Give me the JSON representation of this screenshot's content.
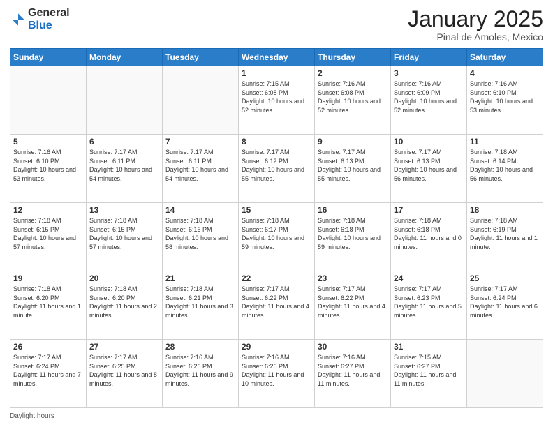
{
  "header": {
    "logo_general": "General",
    "logo_blue": "Blue",
    "month_title": "January 2025",
    "location": "Pinal de Amoles, Mexico"
  },
  "days_of_week": [
    "Sunday",
    "Monday",
    "Tuesday",
    "Wednesday",
    "Thursday",
    "Friday",
    "Saturday"
  ],
  "weeks": [
    [
      {
        "num": "",
        "empty": true
      },
      {
        "num": "",
        "empty": true
      },
      {
        "num": "",
        "empty": true
      },
      {
        "num": "1",
        "sunrise": "7:15 AM",
        "sunset": "6:08 PM",
        "daylight": "10 hours and 52 minutes."
      },
      {
        "num": "2",
        "sunrise": "7:16 AM",
        "sunset": "6:08 PM",
        "daylight": "10 hours and 52 minutes."
      },
      {
        "num": "3",
        "sunrise": "7:16 AM",
        "sunset": "6:09 PM",
        "daylight": "10 hours and 52 minutes."
      },
      {
        "num": "4",
        "sunrise": "7:16 AM",
        "sunset": "6:10 PM",
        "daylight": "10 hours and 53 minutes."
      }
    ],
    [
      {
        "num": "5",
        "sunrise": "7:16 AM",
        "sunset": "6:10 PM",
        "daylight": "10 hours and 53 minutes."
      },
      {
        "num": "6",
        "sunrise": "7:17 AM",
        "sunset": "6:11 PM",
        "daylight": "10 hours and 54 minutes."
      },
      {
        "num": "7",
        "sunrise": "7:17 AM",
        "sunset": "6:11 PM",
        "daylight": "10 hours and 54 minutes."
      },
      {
        "num": "8",
        "sunrise": "7:17 AM",
        "sunset": "6:12 PM",
        "daylight": "10 hours and 55 minutes."
      },
      {
        "num": "9",
        "sunrise": "7:17 AM",
        "sunset": "6:13 PM",
        "daylight": "10 hours and 55 minutes."
      },
      {
        "num": "10",
        "sunrise": "7:17 AM",
        "sunset": "6:13 PM",
        "daylight": "10 hours and 56 minutes."
      },
      {
        "num": "11",
        "sunrise": "7:18 AM",
        "sunset": "6:14 PM",
        "daylight": "10 hours and 56 minutes."
      }
    ],
    [
      {
        "num": "12",
        "sunrise": "7:18 AM",
        "sunset": "6:15 PM",
        "daylight": "10 hours and 57 minutes."
      },
      {
        "num": "13",
        "sunrise": "7:18 AM",
        "sunset": "6:15 PM",
        "daylight": "10 hours and 57 minutes."
      },
      {
        "num": "14",
        "sunrise": "7:18 AM",
        "sunset": "6:16 PM",
        "daylight": "10 hours and 58 minutes."
      },
      {
        "num": "15",
        "sunrise": "7:18 AM",
        "sunset": "6:17 PM",
        "daylight": "10 hours and 59 minutes."
      },
      {
        "num": "16",
        "sunrise": "7:18 AM",
        "sunset": "6:18 PM",
        "daylight": "10 hours and 59 minutes."
      },
      {
        "num": "17",
        "sunrise": "7:18 AM",
        "sunset": "6:18 PM",
        "daylight": "11 hours and 0 minutes."
      },
      {
        "num": "18",
        "sunrise": "7:18 AM",
        "sunset": "6:19 PM",
        "daylight": "11 hours and 1 minute."
      }
    ],
    [
      {
        "num": "19",
        "sunrise": "7:18 AM",
        "sunset": "6:20 PM",
        "daylight": "11 hours and 1 minute."
      },
      {
        "num": "20",
        "sunrise": "7:18 AM",
        "sunset": "6:20 PM",
        "daylight": "11 hours and 2 minutes."
      },
      {
        "num": "21",
        "sunrise": "7:18 AM",
        "sunset": "6:21 PM",
        "daylight": "11 hours and 3 minutes."
      },
      {
        "num": "22",
        "sunrise": "7:17 AM",
        "sunset": "6:22 PM",
        "daylight": "11 hours and 4 minutes."
      },
      {
        "num": "23",
        "sunrise": "7:17 AM",
        "sunset": "6:22 PM",
        "daylight": "11 hours and 4 minutes."
      },
      {
        "num": "24",
        "sunrise": "7:17 AM",
        "sunset": "6:23 PM",
        "daylight": "11 hours and 5 minutes."
      },
      {
        "num": "25",
        "sunrise": "7:17 AM",
        "sunset": "6:24 PM",
        "daylight": "11 hours and 6 minutes."
      }
    ],
    [
      {
        "num": "26",
        "sunrise": "7:17 AM",
        "sunset": "6:24 PM",
        "daylight": "11 hours and 7 minutes."
      },
      {
        "num": "27",
        "sunrise": "7:17 AM",
        "sunset": "6:25 PM",
        "daylight": "11 hours and 8 minutes."
      },
      {
        "num": "28",
        "sunrise": "7:16 AM",
        "sunset": "6:26 PM",
        "daylight": "11 hours and 9 minutes."
      },
      {
        "num": "29",
        "sunrise": "7:16 AM",
        "sunset": "6:26 PM",
        "daylight": "11 hours and 10 minutes."
      },
      {
        "num": "30",
        "sunrise": "7:16 AM",
        "sunset": "6:27 PM",
        "daylight": "11 hours and 11 minutes."
      },
      {
        "num": "31",
        "sunrise": "7:15 AM",
        "sunset": "6:27 PM",
        "daylight": "11 hours and 11 minutes."
      },
      {
        "num": "",
        "empty": true
      }
    ]
  ],
  "footer": {
    "daylight_label": "Daylight hours"
  }
}
